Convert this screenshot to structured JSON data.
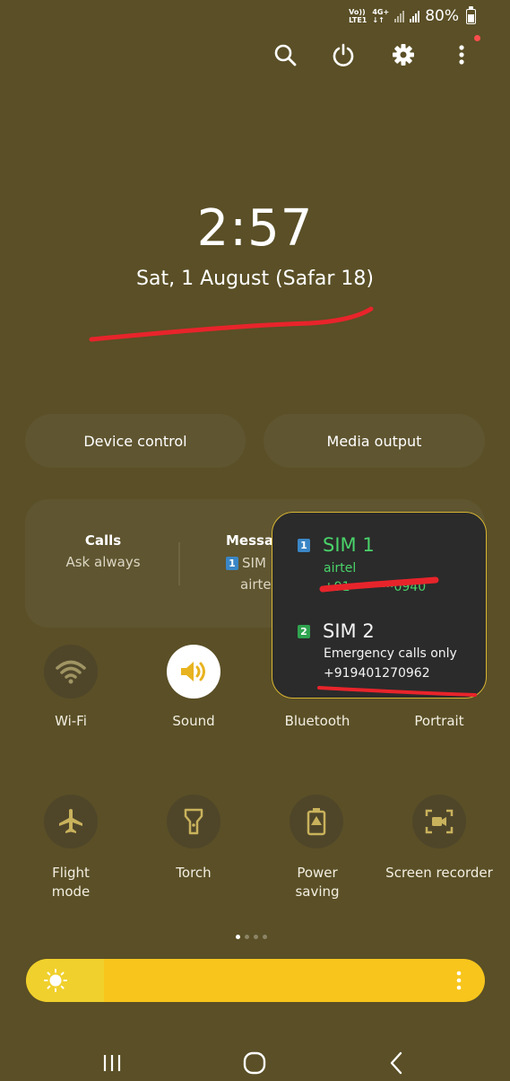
{
  "status_bar": {
    "volte_top": "Vo))",
    "volte_bottom": "LTE1",
    "net_top": "4G+",
    "net_bottom": "↓↑",
    "battery_text": "80%",
    "battery_level": 0.8
  },
  "top_icons": [
    "search-icon",
    "power-icon",
    "gear-icon",
    "more-vert-icon"
  ],
  "clock": {
    "time": "2:57",
    "date": "Sat, 1 August (Safar 18)"
  },
  "pills": {
    "device_control": "Device control",
    "media_output": "Media output"
  },
  "sim_card": {
    "calls_title": "Calls",
    "calls_value": "Ask always",
    "messages_title": "Messag",
    "messages_sim_badge": "1",
    "messages_sim": "SIM",
    "messages_carrier": "airtel"
  },
  "sim_popup": {
    "sim1": {
      "badge": "1",
      "name": "SIM 1",
      "carrier": "airtel",
      "number_partial": "+91···········0940"
    },
    "sim2": {
      "badge": "2",
      "name": "SIM 2",
      "status": "Emergency calls only",
      "number": "+919401270962"
    }
  },
  "tiles_row1": [
    {
      "label": "Wi-Fi",
      "icon": "wifi-icon"
    },
    {
      "label": "Sound",
      "icon": "sound-icon"
    },
    {
      "label": "Bluetooth",
      "icon": "bluetooth-icon"
    },
    {
      "label": "Portrait",
      "icon": "portrait-icon"
    }
  ],
  "tiles_row2": [
    {
      "label": "Flight\nmode",
      "icon": "airplane-icon"
    },
    {
      "label": "Torch",
      "icon": "torch-icon"
    },
    {
      "label": "Power\nsaving",
      "icon": "battery-saver-icon"
    },
    {
      "label": "Screen recorder",
      "icon": "screen-record-icon"
    }
  ],
  "page_indicator": {
    "pages": 4,
    "current": 1
  },
  "brightness": {
    "level": 0.17
  },
  "colors": {
    "background": "#5a4f26",
    "accent_yellow": "#f7c51c",
    "sim_green": "#4ad36a",
    "annotation_red": "#e8242b"
  },
  "navbar": [
    "recent-apps-icon",
    "home-icon",
    "back-icon"
  ]
}
